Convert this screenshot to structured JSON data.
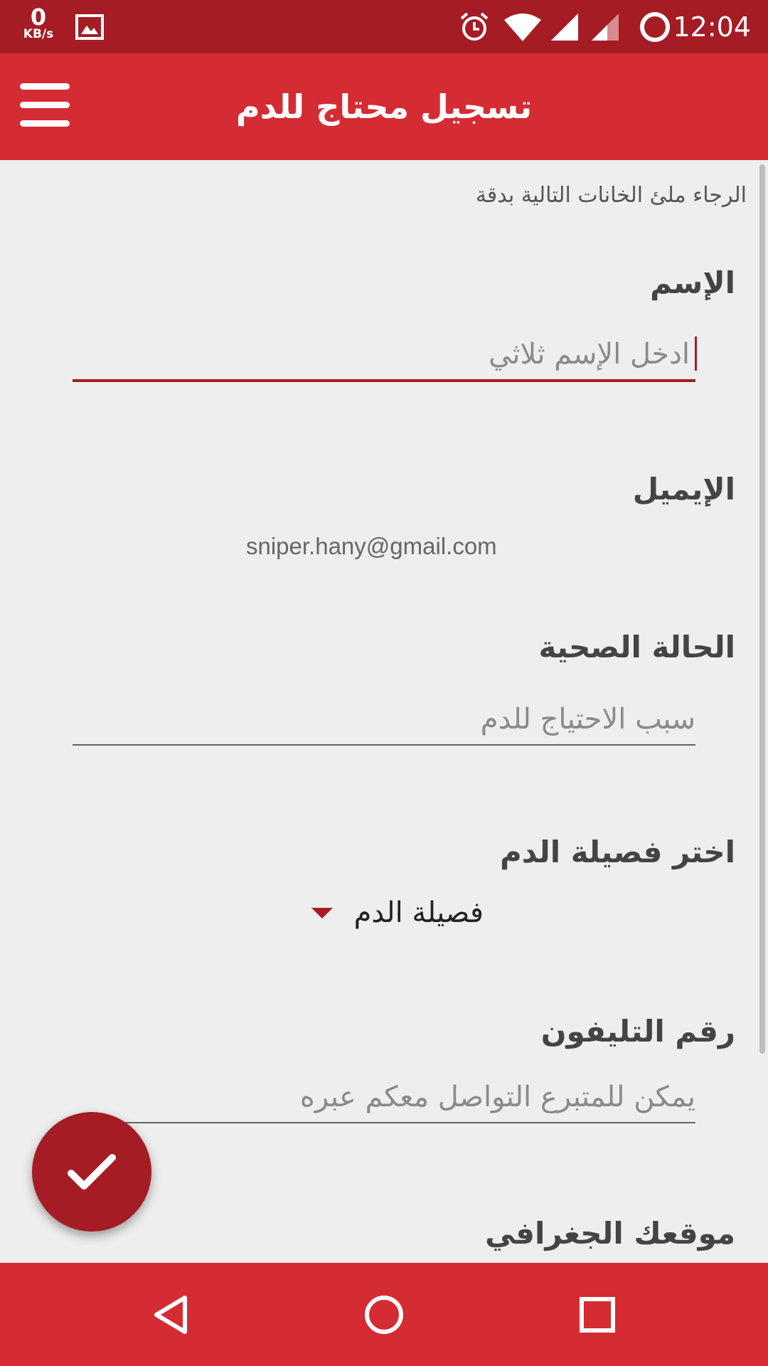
{
  "status_bar": {
    "net_speed_value": "0",
    "net_speed_unit": "KB/s",
    "time": "12:04",
    "icons": [
      "image-icon",
      "alarm-icon",
      "wifi-icon",
      "signal-icon",
      "signal-icon",
      "battery-icon"
    ]
  },
  "app_bar": {
    "title": "تسجيل محتاج للدم",
    "menu_icon": "hamburger-menu-icon"
  },
  "form": {
    "intro": "الرجاء ملئ الخانات التالية بدقة",
    "name": {
      "label": "الإسم",
      "placeholder": "ادخل الإسم ثلاثي"
    },
    "email": {
      "label": "الإيميل",
      "value": "sniper.hany@gmail.com"
    },
    "health": {
      "label": "الحالة الصحية",
      "placeholder": "سبب الاحتياج للدم"
    },
    "blood_type": {
      "label": "اختر فصيلة الدم",
      "selected": "فصيلة الدم"
    },
    "phone": {
      "label": "رقم التليفون",
      "placeholder": "يمكن للمتبرع التواصل معكم عبره"
    },
    "location": {
      "label": "موقعك الجغرافي"
    }
  },
  "fab": {
    "icon": "checkmark-icon"
  },
  "nav_bar": {
    "icons": [
      "back-icon",
      "home-icon",
      "recents-icon"
    ]
  },
  "colors": {
    "status_bar": "#a51c24",
    "app_bar": "#d52b33",
    "accent": "#a51c24",
    "background": "#eeeeee"
  }
}
